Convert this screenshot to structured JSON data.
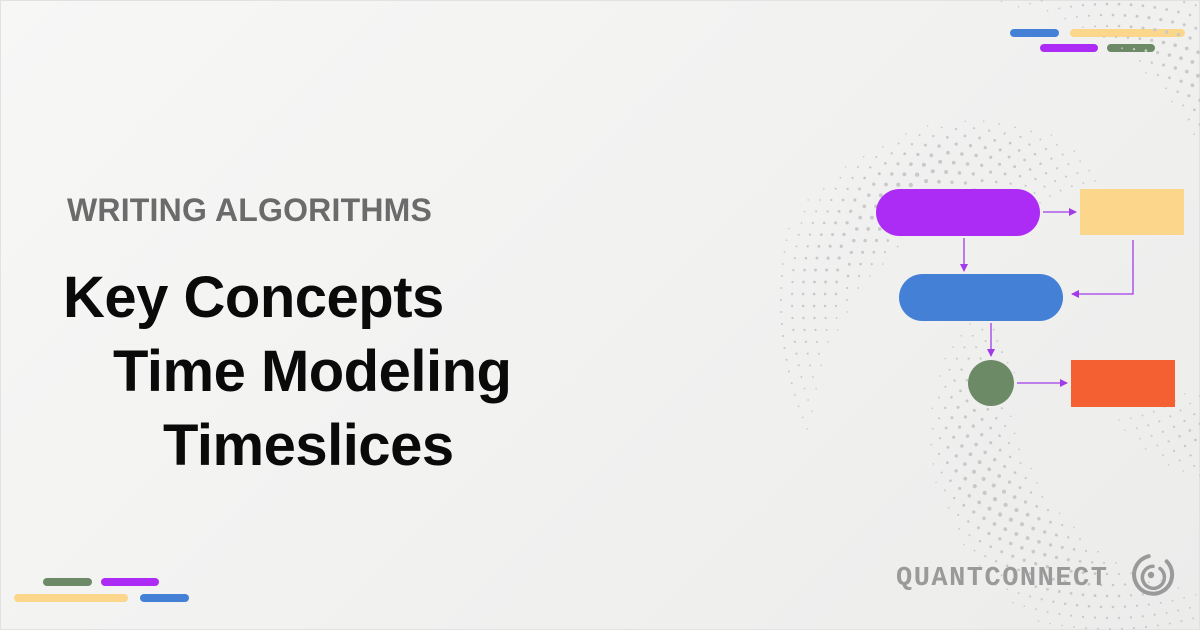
{
  "header": {
    "eyebrow": "WRITING ALGORITHMS",
    "title_lines": [
      "Key Concepts",
      "Time Modeling",
      "Timeslices"
    ]
  },
  "brand": {
    "name": "QUANTCONNECT",
    "logo_icon": "quantconnect-logo-icon"
  },
  "colors": {
    "purple": "#ad2cf5",
    "yellow": "#fcd68a",
    "blue": "#4480d6",
    "green": "#6d8a67",
    "orange": "#f46031",
    "arrow": "#a23ce8",
    "dots": "#c9c9c9"
  }
}
